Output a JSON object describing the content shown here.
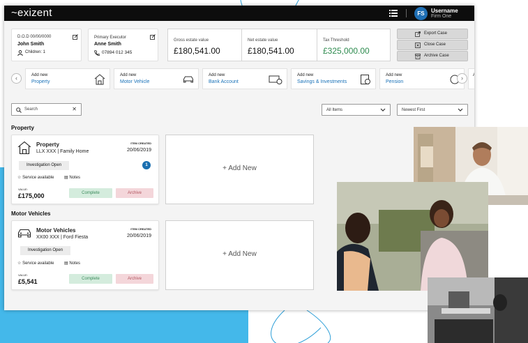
{
  "header": {
    "logo": "~exizent",
    "user_initials": "FS",
    "username": "Username",
    "firm": "Firm One"
  },
  "deceased": {
    "dod": "D.O.D 00/00/0000",
    "name": "John Smith",
    "children": "Children: 1"
  },
  "executor": {
    "label": "Primary Executor",
    "name": "Anne Smith",
    "phone": "07894 012 345"
  },
  "totals": [
    {
      "label": "Gross estate value",
      "value": "£180,541.00"
    },
    {
      "label": "Net estate value",
      "value": "£180,541.00"
    },
    {
      "label": "Tax Threshold",
      "value": "£325,000.00"
    }
  ],
  "case_actions": [
    "Export Case",
    "Close Case",
    "Archive Case"
  ],
  "categories": [
    {
      "add": "Add new",
      "name": "Property"
    },
    {
      "add": "Add new",
      "name": "Motor Vehicle"
    },
    {
      "add": "Add new",
      "name": "Bank Account"
    },
    {
      "add": "Add new",
      "name": "Savings & Investments"
    },
    {
      "add": "Add new",
      "name": "Pension"
    },
    {
      "add": "A",
      "name": ""
    }
  ],
  "filters": {
    "search_placeholder": "Search",
    "clear_glyph": "✕",
    "items": "All Items",
    "sort": "Newest First"
  },
  "sections": [
    {
      "title": "Property",
      "add_new": "+  Add New",
      "item": {
        "title": "Property",
        "subtitle": "LLX XXX | Family Home",
        "created_label": "ITEM CREATED",
        "date": "20/06/2019",
        "status": "Investigation Open",
        "badge": "1",
        "star_glyph": "☆",
        "service": "Service available",
        "notes_glyph": "▤",
        "notes": "Notes",
        "value_label": "VALUE:",
        "value": "£175,000",
        "complete": "Complete",
        "archive": "Archive"
      }
    },
    {
      "title": "Motor Vehicles",
      "add_new": "+  Add New",
      "item": {
        "title": "Motor Vehicles",
        "subtitle": "XX00 XXX | Ford Fiesta",
        "created_label": "ITEM CREATED",
        "date": "20/06/2019",
        "status": "Investigation Open",
        "star_glyph": "☆",
        "service": "Service available",
        "notes_glyph": "▤",
        "notes": "Notes",
        "value_label": "VALUE:",
        "value": "£5,541",
        "complete": "Complete",
        "archive": "Archive"
      }
    }
  ],
  "colors": {
    "accent_blue": "#1a72b8",
    "background_blue": "#44b8ea",
    "tax_green": "#2e8b4f",
    "complete_bg": "#d4ecdd",
    "archive_bg": "#f4d6da"
  }
}
